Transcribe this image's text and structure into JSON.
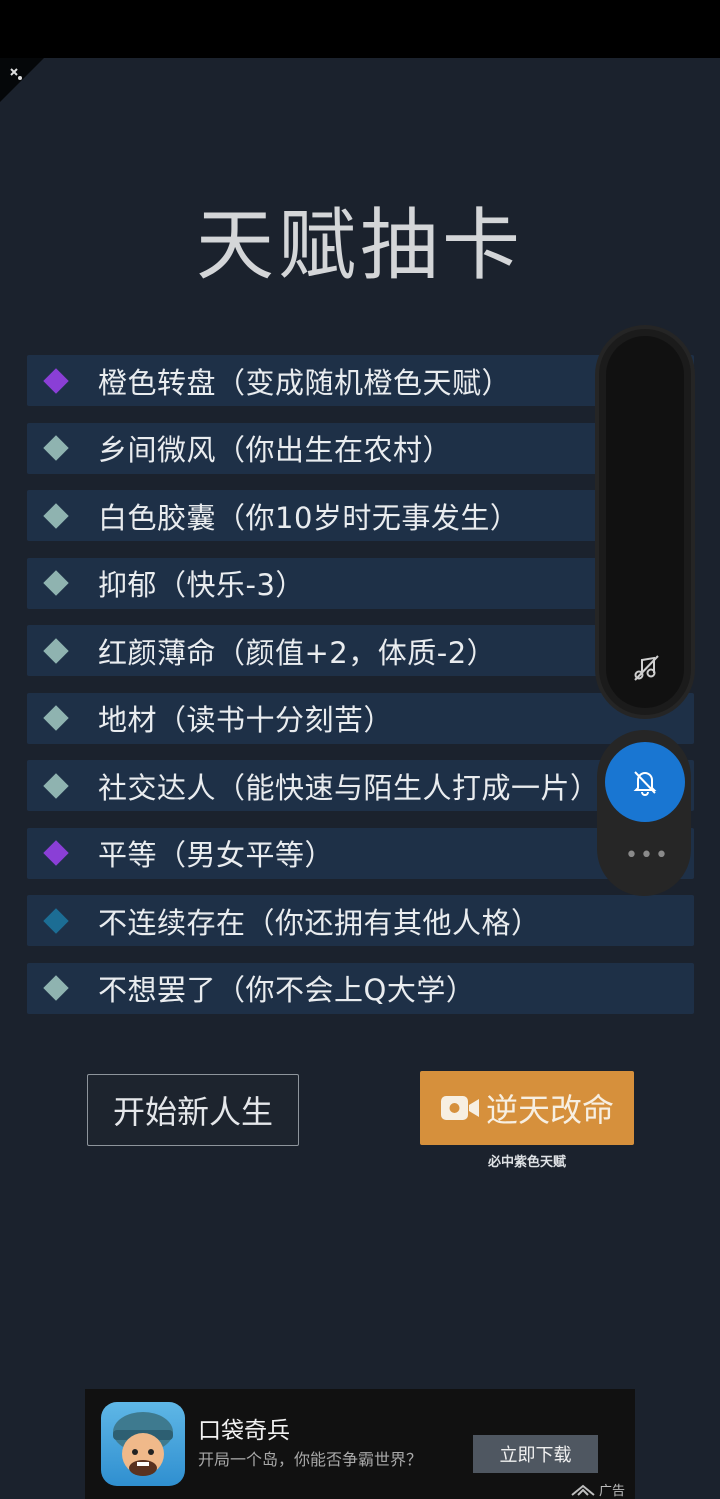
{
  "page": {
    "title": "天赋抽卡"
  },
  "talents": [
    {
      "name": "橙色转盘（变成随机橙色天赋）",
      "gem_color": "#8a3fd6"
    },
    {
      "name": "乡间微风（你出生在农村）",
      "gem_color": "#8fb3b0"
    },
    {
      "name": "白色胶囊（你10岁时无事发生）",
      "gem_color": "#8fb3b0"
    },
    {
      "name": "抑郁（快乐-3）",
      "gem_color": "#8fb3b0"
    },
    {
      "name": "红颜薄命（颜值+2，体质-2）",
      "gem_color": "#8fb3b0"
    },
    {
      "name": "地材（读书十分刻苦）",
      "gem_color": "#8fb3b0"
    },
    {
      "name": "社交达人（能快速与陌生人打成一片）",
      "gem_color": "#8fb3b0"
    },
    {
      "name": "平等（男女平等）",
      "gem_color": "#8a3fd6"
    },
    {
      "name": "不连续存在（你还拥有其他人格）",
      "gem_color": "#1c6d94"
    },
    {
      "name": "不想罢了（你不会上Q大学）",
      "gem_color": "#8fb3b0"
    }
  ],
  "actions": {
    "start_label": "开始新人生",
    "revive_label": "逆天改命",
    "revive_sub": "必中紫色天赋"
  },
  "floating_controls": {
    "music_icon": "music-off-icon",
    "bell_icon": "bell-off-icon",
    "more_label": "•••",
    "bell_color": "#1976d2"
  },
  "ad": {
    "title": "口袋奇兵",
    "desc": "开局一个岛，你能否争霸世界？",
    "button": "立即下载",
    "tag": "广告"
  }
}
